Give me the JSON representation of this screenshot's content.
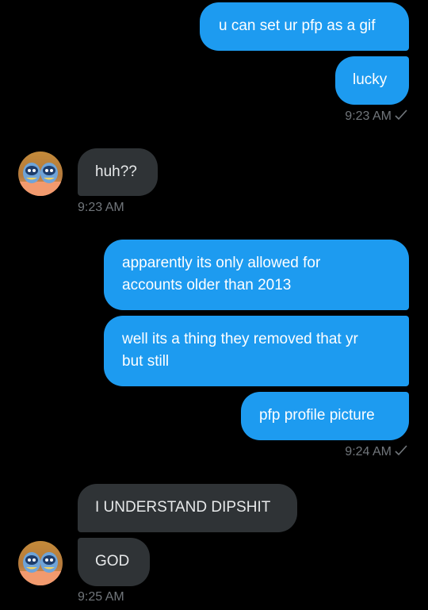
{
  "messages": {
    "m1": "u can set ur pfp as a gif",
    "m2": "lucky",
    "t1": "9:23 AM",
    "m3": "huh??",
    "t2": "9:23 AM",
    "m4_line1": "apparently its only allowed for",
    "m4_line2": "accounts older than 2013",
    "m5_line1": "well its a thing they removed that yr",
    "m5_line2": "but still",
    "m6": "pfp profile picture",
    "t3": "9:24 AM",
    "m7": "I UNDERSTAND DIPSHIT",
    "m8": "GOD",
    "t4": "9:25 AM"
  },
  "icons": {
    "read_receipt": "checkmark-icon",
    "avatar": "avatar-icon"
  },
  "colors": {
    "sent_bubble": "#1d9bf0",
    "received_bubble": "#2f3336",
    "timestamp": "#71767b",
    "background": "#000000"
  }
}
